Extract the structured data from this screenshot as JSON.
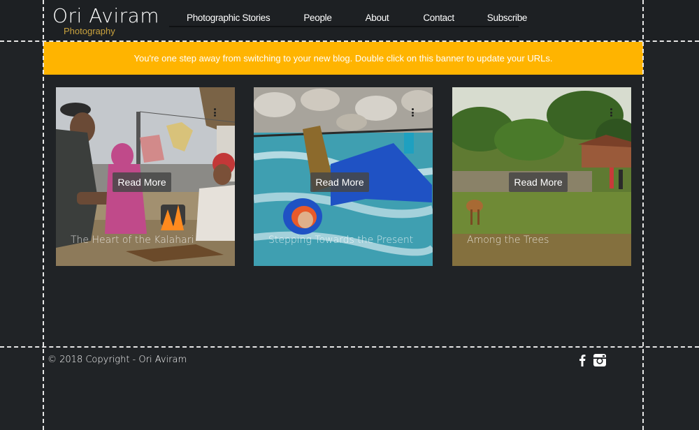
{
  "header": {
    "logo_name": "Ori Aviram",
    "logo_sub": "Photography"
  },
  "nav": {
    "items": [
      "Photographic Stories",
      "People",
      "About",
      "Contact",
      "Subscribe"
    ]
  },
  "banner": {
    "text": "You're one step away from switching to your new blog. Double click on this banner to update your URLs.",
    "color": "#ffb400"
  },
  "cards": [
    {
      "title": "The Heart of the Kalahari",
      "button": "Read More"
    },
    {
      "title": "Stepping Towards the Present",
      "button": "Read More"
    },
    {
      "title": "Among the Trees",
      "button": "Read More"
    }
  ],
  "footer": {
    "copyright": "© 2018 Copyright - Ori Aviram",
    "social_icons": [
      "facebook-icon",
      "instagram-icon"
    ]
  },
  "colors": {
    "background": "#202326",
    "accent": "#c9a23e"
  }
}
